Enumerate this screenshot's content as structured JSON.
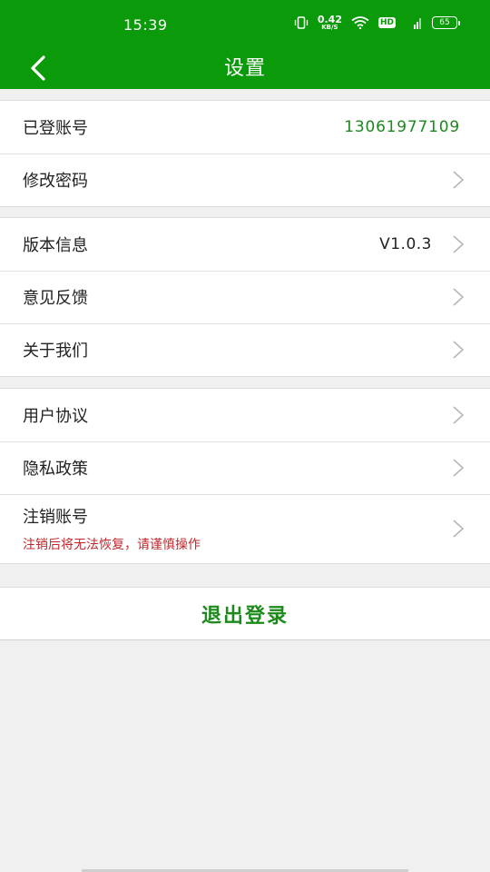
{
  "status_bar": {
    "time": "15:39",
    "speed_value": "0.42",
    "speed_unit": "KB/S",
    "hd": "HD",
    "network": "4G",
    "battery": "65"
  },
  "header": {
    "title": "设置"
  },
  "account_group": {
    "account_label": "已登账号",
    "account_value": "13061977109",
    "change_password_label": "修改密码"
  },
  "info_group": {
    "version_label": "版本信息",
    "version_value": "V1.0.3",
    "feedback_label": "意见反馈",
    "about_label": "关于我们"
  },
  "policy_group": {
    "user_agreement_label": "用户协议",
    "privacy_label": "隐私政策",
    "delete_account_label": "注销账号",
    "delete_account_warning": "注销后将无法恢复，请谨慎操作"
  },
  "logout": {
    "label": "退出登录"
  },
  "colors": {
    "brand_green": "#0a9a0a",
    "value_green": "#1b8a1b",
    "warning_red": "#c0282d"
  }
}
